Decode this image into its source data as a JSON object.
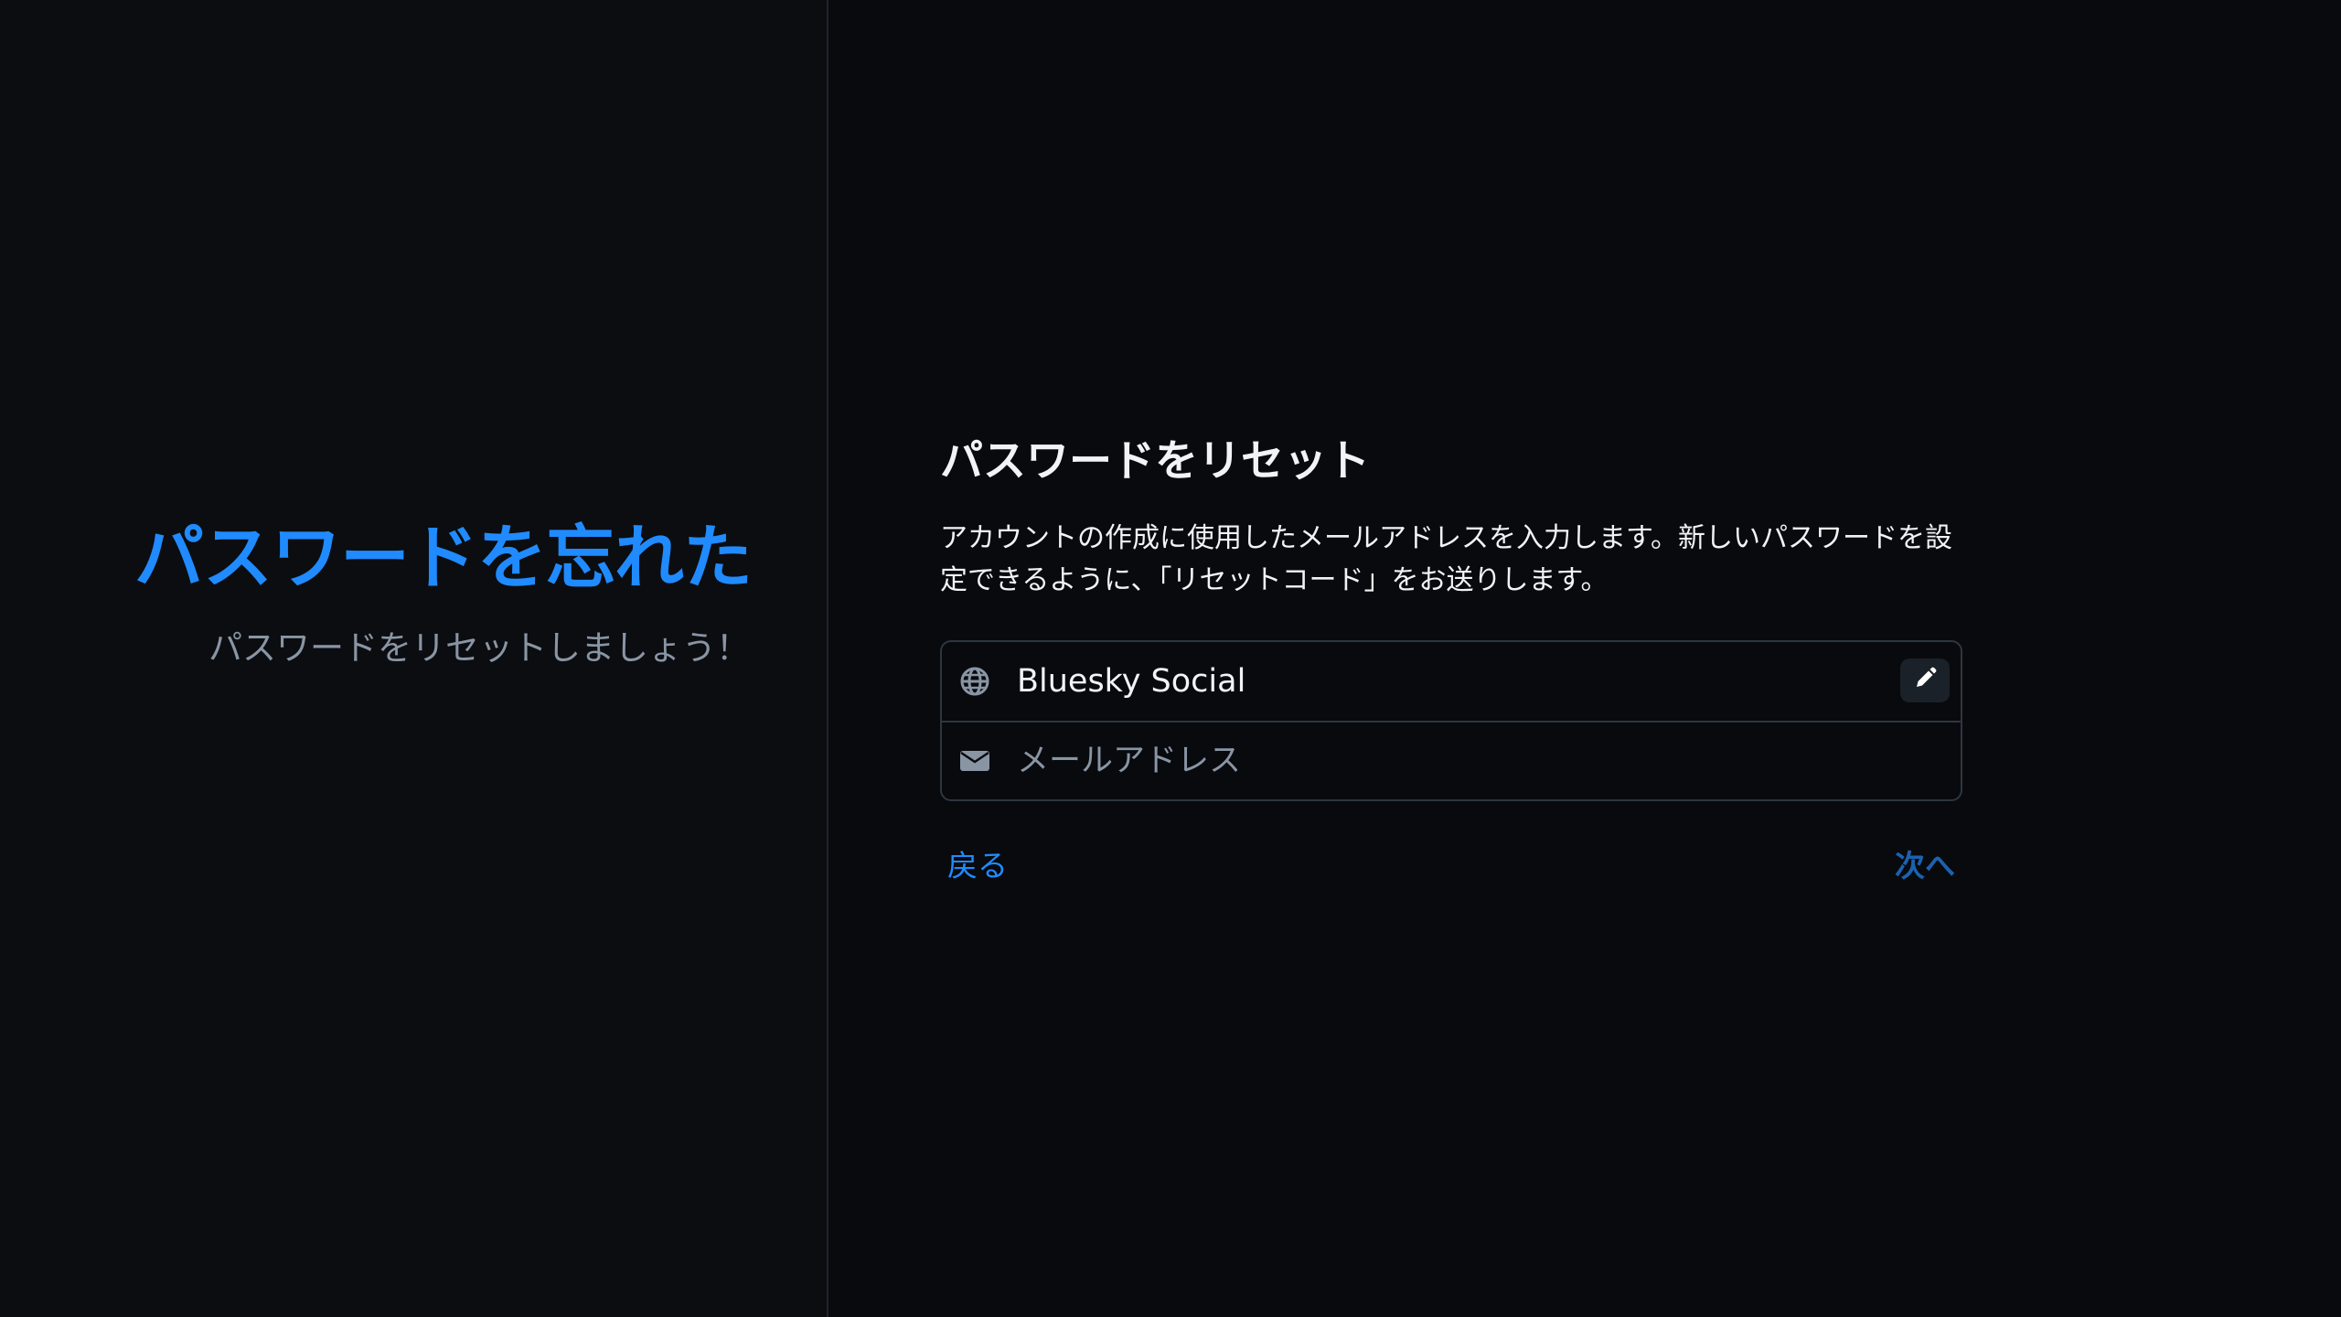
{
  "left_panel": {
    "title": "パスワードを忘れた",
    "subtitle": "パスワードをリセットしましょう！"
  },
  "form": {
    "title": "パスワードをリセット",
    "description": "アカウントの作成に使用したメールアドレスを入力します。新しいパスワードを設定できるように、「リセットコード」をお送りします。",
    "hosting_provider": {
      "icon": "globe-icon",
      "value": "Bluesky Social",
      "edit_icon": "pencil-icon"
    },
    "email": {
      "icon": "envelope-icon",
      "value": "",
      "placeholder": "メールアドレス"
    }
  },
  "actions": {
    "back_label": "戻る",
    "next_label": "次へ"
  },
  "colors": {
    "background": "#080a0e",
    "left_panel_background": "#0b0d11",
    "accent": "#208bfe",
    "next_disabled": "#1b62b0",
    "text_primary": "#f1f3f5",
    "text_secondary": "#8a95a4",
    "border": "#2e3640"
  }
}
